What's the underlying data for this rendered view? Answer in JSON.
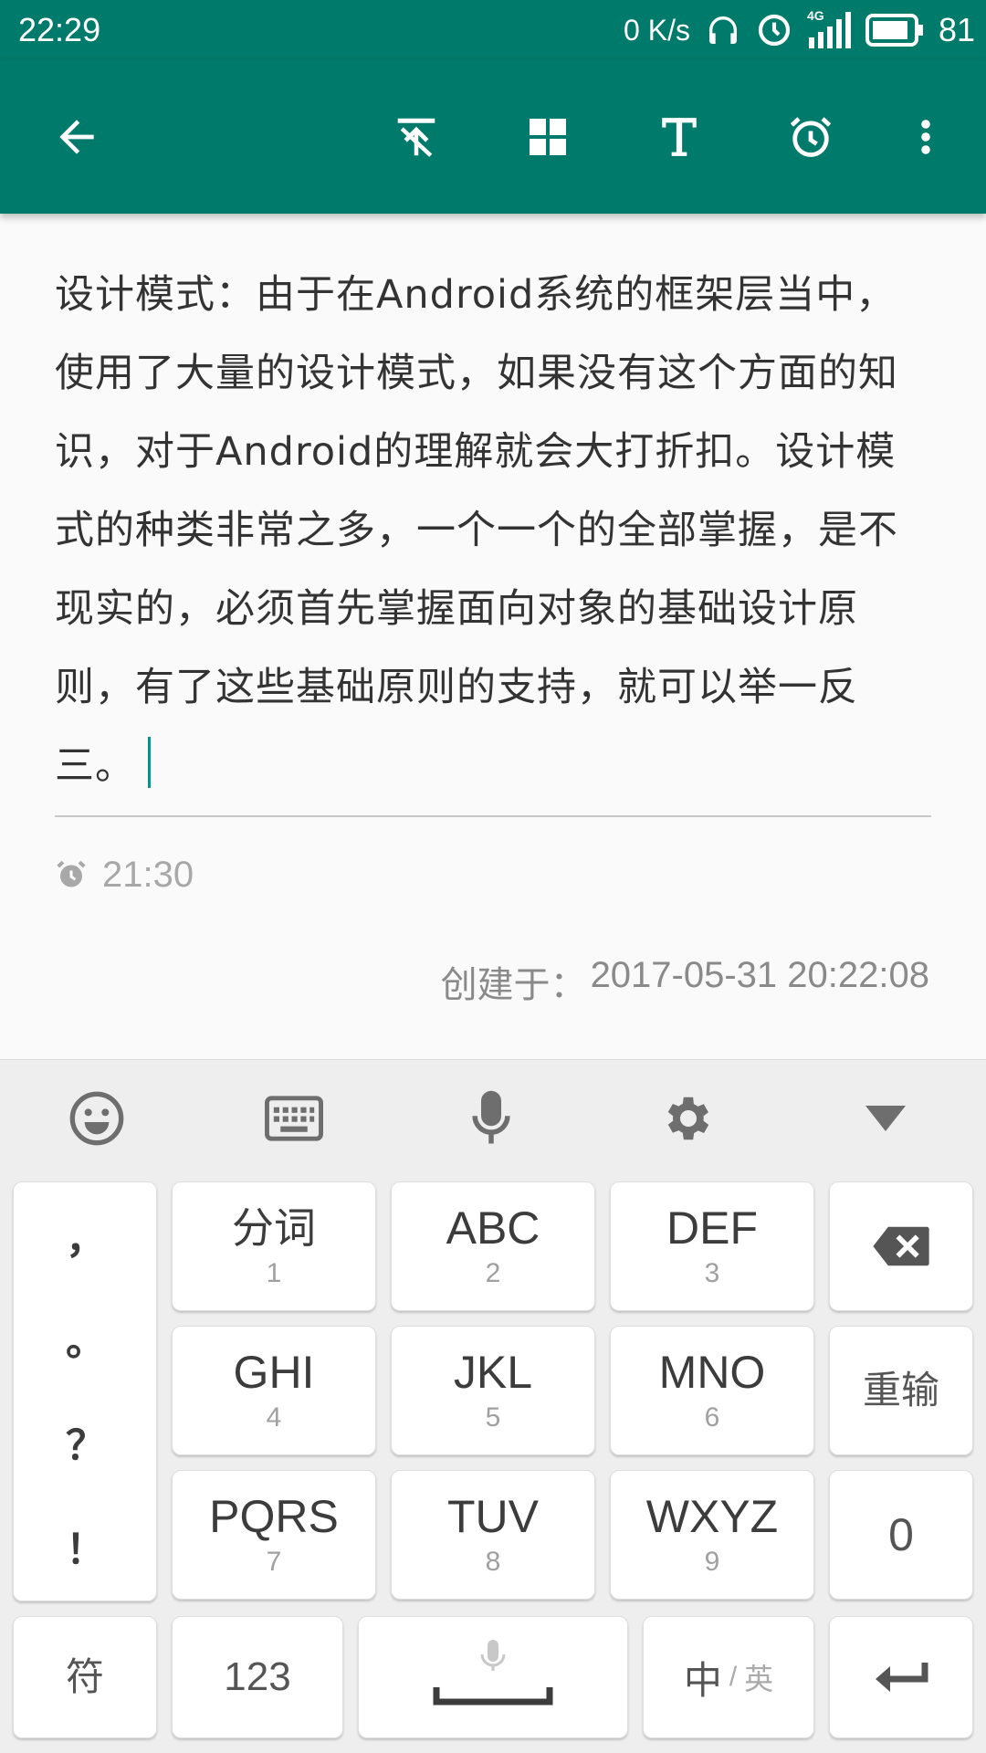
{
  "status_bar": {
    "time": "22:29",
    "net_speed": "0 K/s",
    "network": "4G",
    "battery": "81"
  },
  "app_bar": {
    "icons": [
      "back-arrow-icon",
      "pin-top-icon",
      "grid-icon",
      "text-format-icon",
      "alarm-icon",
      "more-vert-icon"
    ]
  },
  "note": {
    "body": "设计模式：由于在Android系统的框架层当中，使用了大量的设计模式，如果没有这个方面的知识，对于Android的理解就会大打折扣。设计模式的种类非常之多，一个一个的全部掌握，是不现实的，必须首先掌握面向对象的基础设计原则，有了这些基础原则的支持，就可以举一反三。",
    "reminder_time": "21:30",
    "created_label": "创建于：",
    "created_time": "2017-05-31 20:22:08"
  },
  "keyboard": {
    "toolbar": [
      "emoji-icon",
      "keyboard-icon",
      "microphone-icon",
      "settings-gear-icon",
      "collapse-triangle-icon"
    ],
    "punctuation": [
      "，",
      "。",
      "？",
      "！"
    ],
    "keys": [
      {
        "label": "分词",
        "num": "1"
      },
      {
        "label": "ABC",
        "num": "2"
      },
      {
        "label": "DEF",
        "num": "3"
      },
      {
        "label": "GHI",
        "num": "4"
      },
      {
        "label": "JKL",
        "num": "5"
      },
      {
        "label": "MNO",
        "num": "6"
      },
      {
        "label": "PQRS",
        "num": "7"
      },
      {
        "label": "TUV",
        "num": "8"
      },
      {
        "label": "WXYZ",
        "num": "9"
      }
    ],
    "reinput": "重输",
    "zero": "0",
    "symbols": "符",
    "numbers": "123",
    "lang_cn": "中",
    "lang_sep": "/",
    "lang_en": "英"
  },
  "colors": {
    "primary": "#007a6a",
    "cursor": "#009688"
  }
}
